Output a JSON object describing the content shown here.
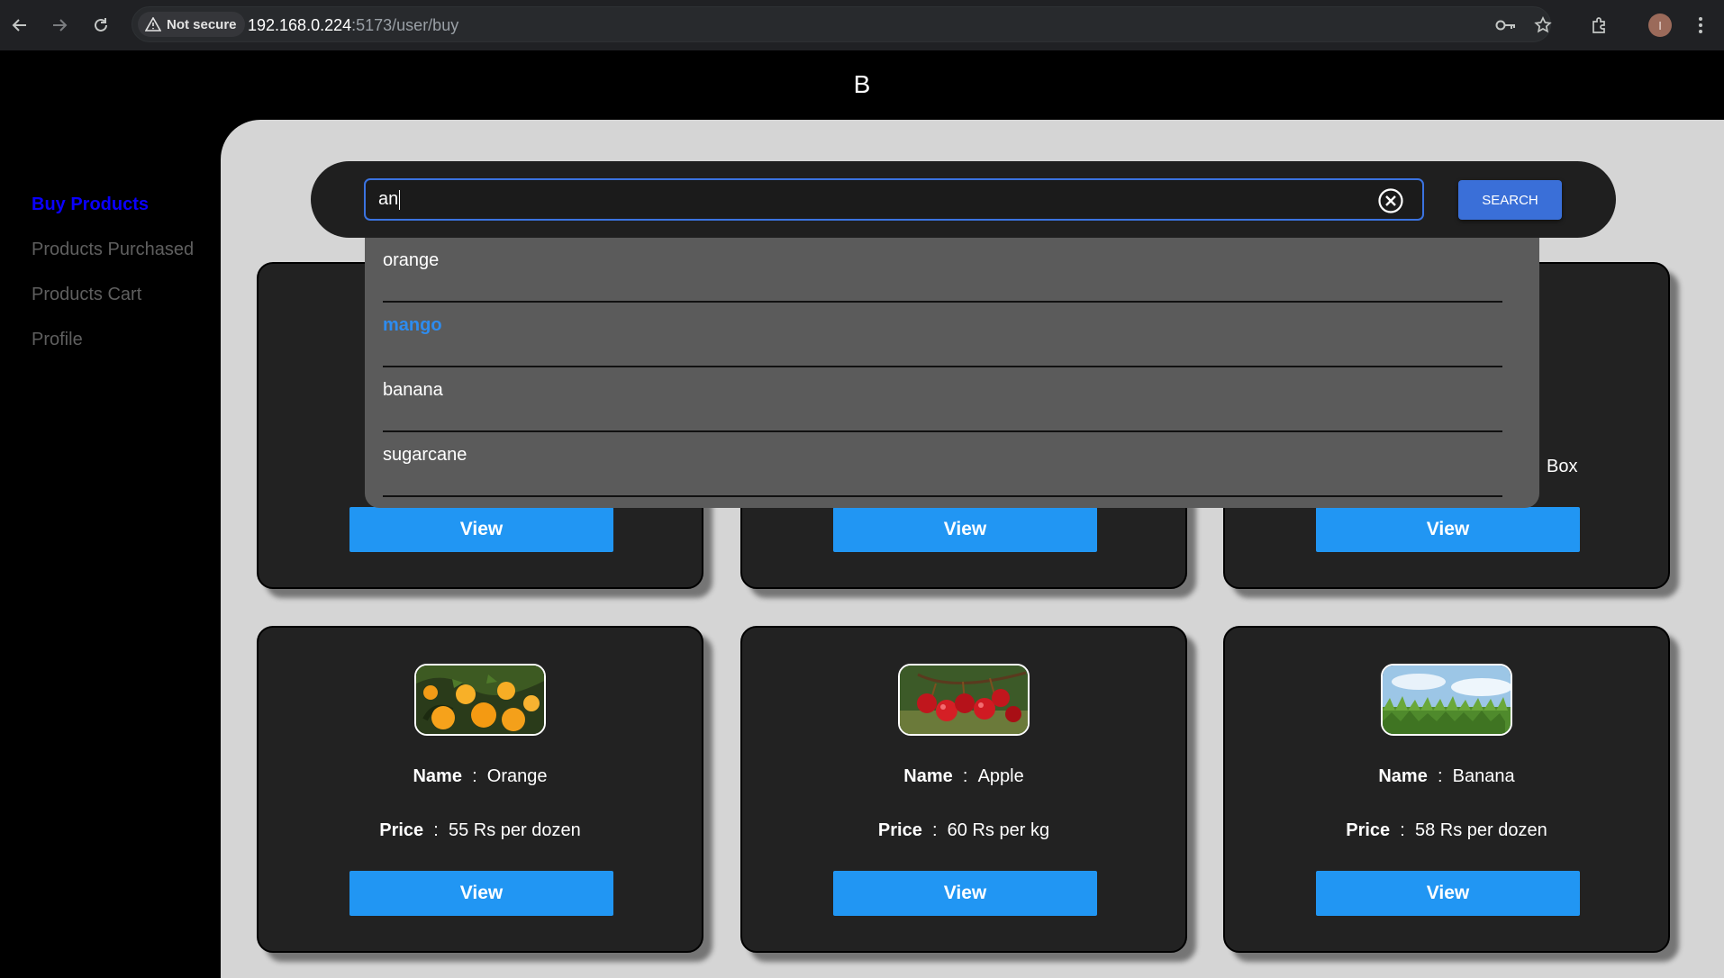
{
  "browser": {
    "security_label": "Not secure",
    "url_host": "192.168.0.224",
    "url_path": ":5173/user/buy",
    "avatar_letter": "I"
  },
  "app": {
    "brand": "B"
  },
  "sidebar": {
    "items": [
      {
        "label": "Buy Products",
        "active": true
      },
      {
        "label": "Products Purchased"
      },
      {
        "label": "Products Cart"
      },
      {
        "label": "Profile"
      }
    ]
  },
  "search": {
    "value": "an",
    "button_label": "SEARCH",
    "suggestions": [
      "orange",
      "mango",
      "banana",
      "sugarcane"
    ],
    "highlighted": "mango"
  },
  "cards_row1": {
    "partial_text": "Box",
    "view_label": "View"
  },
  "cards_row2": [
    {
      "name_label": "Name",
      "name": "Orange",
      "price_label": "Price",
      "price": "55 Rs per dozen",
      "view_label": "View"
    },
    {
      "name_label": "Name",
      "name": "Apple",
      "price_label": "Price",
      "price": "60 Rs per kg",
      "view_label": "View"
    },
    {
      "name_label": "Name",
      "name": "Banana",
      "price_label": "Price",
      "price": "58 Rs per dozen",
      "view_label": "View"
    }
  ],
  "separator": ":",
  "colors": {
    "accent": "#2196f3",
    "active_nav": "#0a00ff",
    "panel": "#d5d5d5",
    "card": "#222222"
  }
}
